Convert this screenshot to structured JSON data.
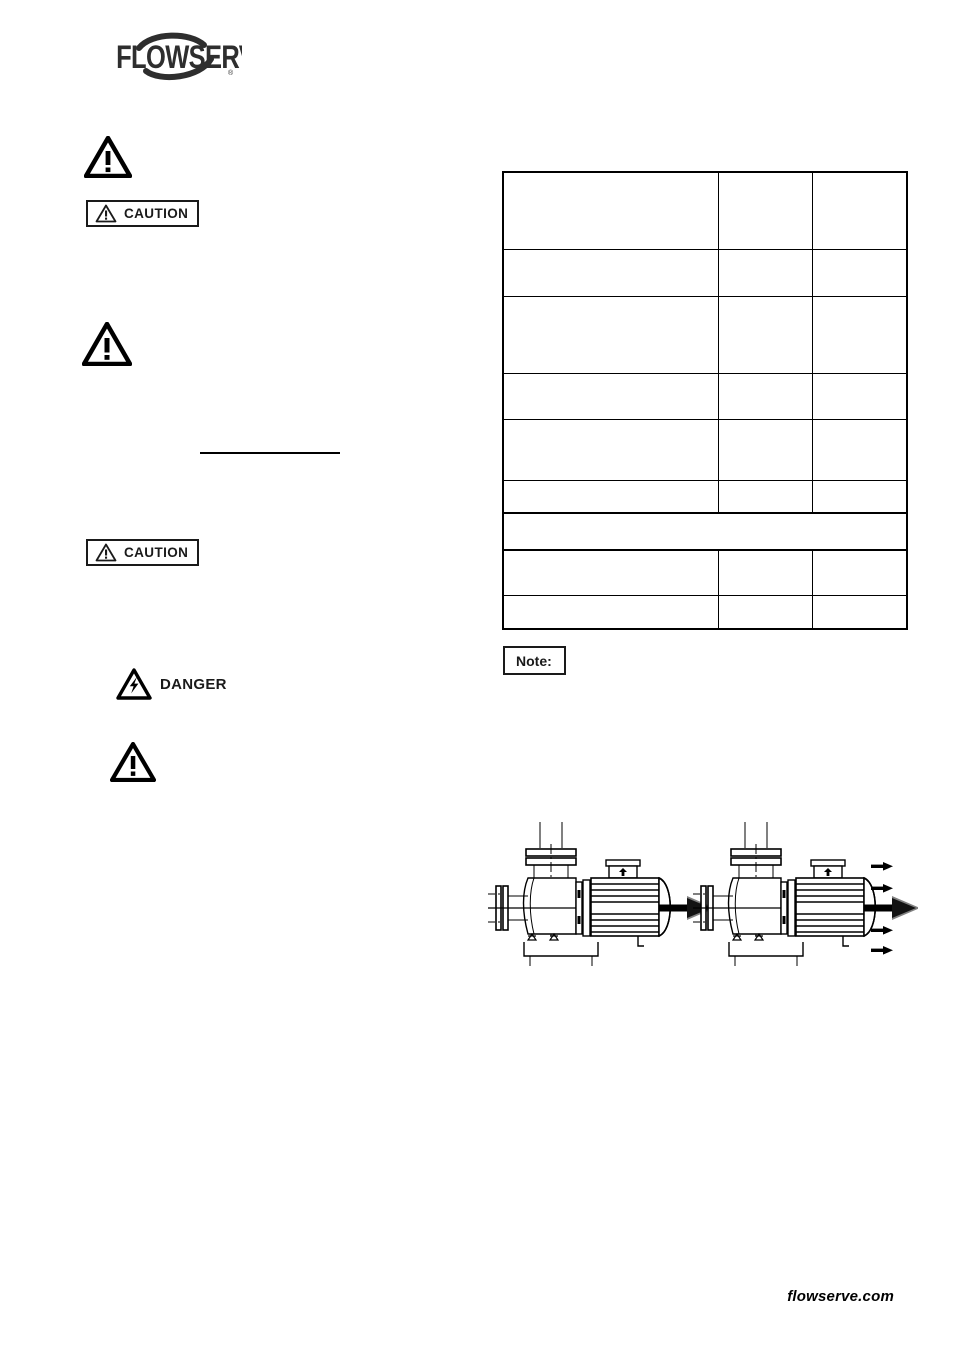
{
  "document": {
    "brand": "FLOWSERVE",
    "brand_registered_mark": "®",
    "footer_url": "flowserve.com"
  },
  "left_column": {
    "notices": [
      {
        "id": "notice-1",
        "kind": "warning-triangle",
        "icon": "warning-triangle-icon",
        "label": ""
      },
      {
        "id": "notice-2",
        "kind": "caution-box",
        "icon": "warning-triangle-icon",
        "label": "CAUTION"
      },
      {
        "id": "notice-3",
        "kind": "warning-triangle",
        "icon": "warning-triangle-icon",
        "label": ""
      },
      {
        "id": "notice-4",
        "kind": "caution-box",
        "icon": "warning-triangle-icon",
        "label": "CAUTION"
      },
      {
        "id": "notice-5",
        "kind": "danger",
        "icon": "electric-shock-triangle-icon",
        "label": "DANGER"
      },
      {
        "id": "notice-6",
        "kind": "warning-triangle",
        "icon": "warning-triangle-icon",
        "label": ""
      }
    ],
    "rule": {
      "present": true
    }
  },
  "right_column": {
    "table": {
      "columns": [
        "",
        "",
        ""
      ],
      "rows": [
        {
          "cells": [
            "",
            "",
            ""
          ],
          "span": false
        },
        {
          "cells": [
            "",
            "",
            ""
          ],
          "span": false
        },
        {
          "cells": [
            "",
            "",
            ""
          ],
          "span": false
        },
        {
          "cells": [
            "",
            "",
            ""
          ],
          "span": false
        },
        {
          "cells": [
            "",
            "",
            ""
          ],
          "span": false
        },
        {
          "cells": [
            "",
            "",
            ""
          ],
          "span": false
        },
        {
          "cells": [
            ""
          ],
          "span": true
        },
        {
          "cells": [
            "",
            "",
            ""
          ],
          "span": false
        },
        {
          "cells": [
            "",
            "",
            ""
          ],
          "span": false
        }
      ]
    },
    "note": {
      "label": "Note:"
    },
    "figure": {
      "caption": "",
      "diagrams": [
        {
          "id": "pump-correct",
          "name": "pump-motor-assembly-single-airflow",
          "arrow_count": 1,
          "description": ""
        },
        {
          "id": "pump-incorrect",
          "name": "pump-motor-assembly-multi-airflow",
          "arrow_count": 5,
          "description": ""
        }
      ]
    }
  },
  "colors": {
    "ink": "#000000",
    "rule": "#1a1a1a",
    "paper": "#ffffff",
    "logo": "#3a3a3a"
  }
}
